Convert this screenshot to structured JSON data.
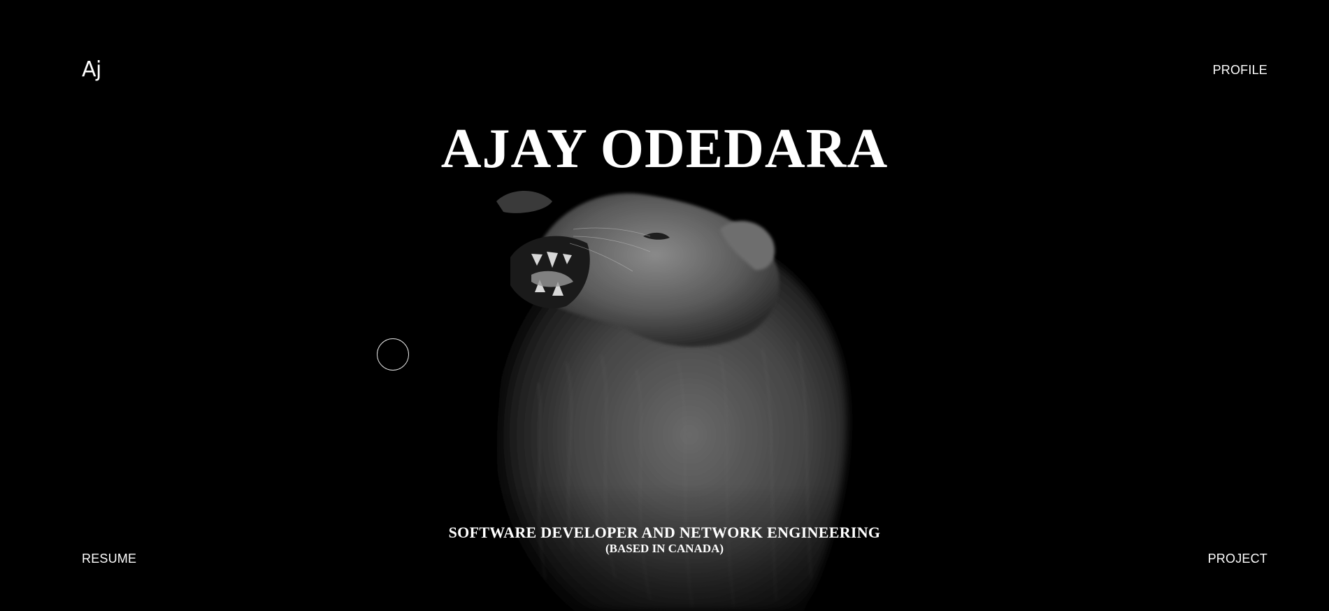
{
  "header": {
    "logo_text": "Aj",
    "profile_label": "PROFILE"
  },
  "hero": {
    "title": "AJAY ODEDARA",
    "subtitle": "SOFTWARE DEVELOPER AND NETWORK ENGINEERING",
    "location": "(BASED IN CANADA)",
    "background_image": "roaring-lion-photo"
  },
  "footer": {
    "resume_label": "RESUME",
    "project_label": "PROJECT"
  },
  "colors": {
    "background": "#000000",
    "text": "#ffffff",
    "cursor_ring": "#e6e6e6"
  }
}
